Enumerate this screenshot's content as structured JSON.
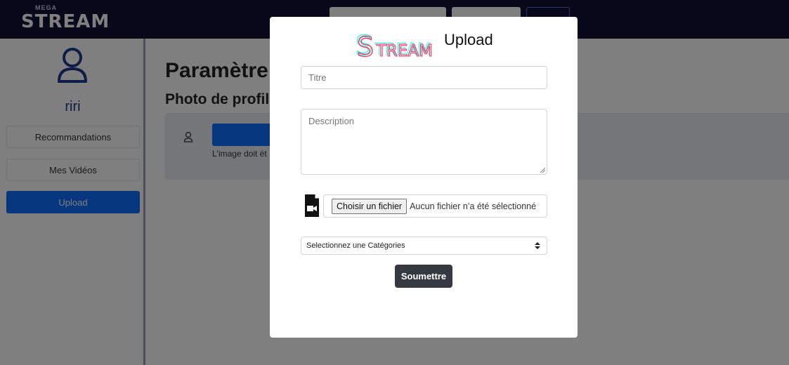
{
  "brand": {
    "small": "MEGA",
    "name": "STREAM"
  },
  "sidebar": {
    "username": "riri",
    "items": [
      {
        "label": "Recommandations",
        "active": false
      },
      {
        "label": "Mes Vidéos",
        "active": false
      },
      {
        "label": "Upload",
        "active": true
      }
    ]
  },
  "main": {
    "title": "Paramètre",
    "subtitle": "Photo de profil",
    "image_note": "L'image doit ét"
  },
  "modal": {
    "logo_text": "STREAM",
    "title": "Upload",
    "title_placeholder": "Titre",
    "description_placeholder": "Description",
    "file_button": "Choisir un fichier",
    "file_status": "Aucun fichier n’a été sélectionné",
    "category_selected": "Selectionnez une Catégories",
    "submit_label": "Soumettre"
  },
  "colors": {
    "navbar": "#0f1236",
    "accent": "#0d6efd",
    "username": "#1a3a8a",
    "submit": "#343a40"
  },
  "icons": {
    "user": "user-icon",
    "file": "video-file-icon",
    "select": "chevron-updown-icon"
  }
}
